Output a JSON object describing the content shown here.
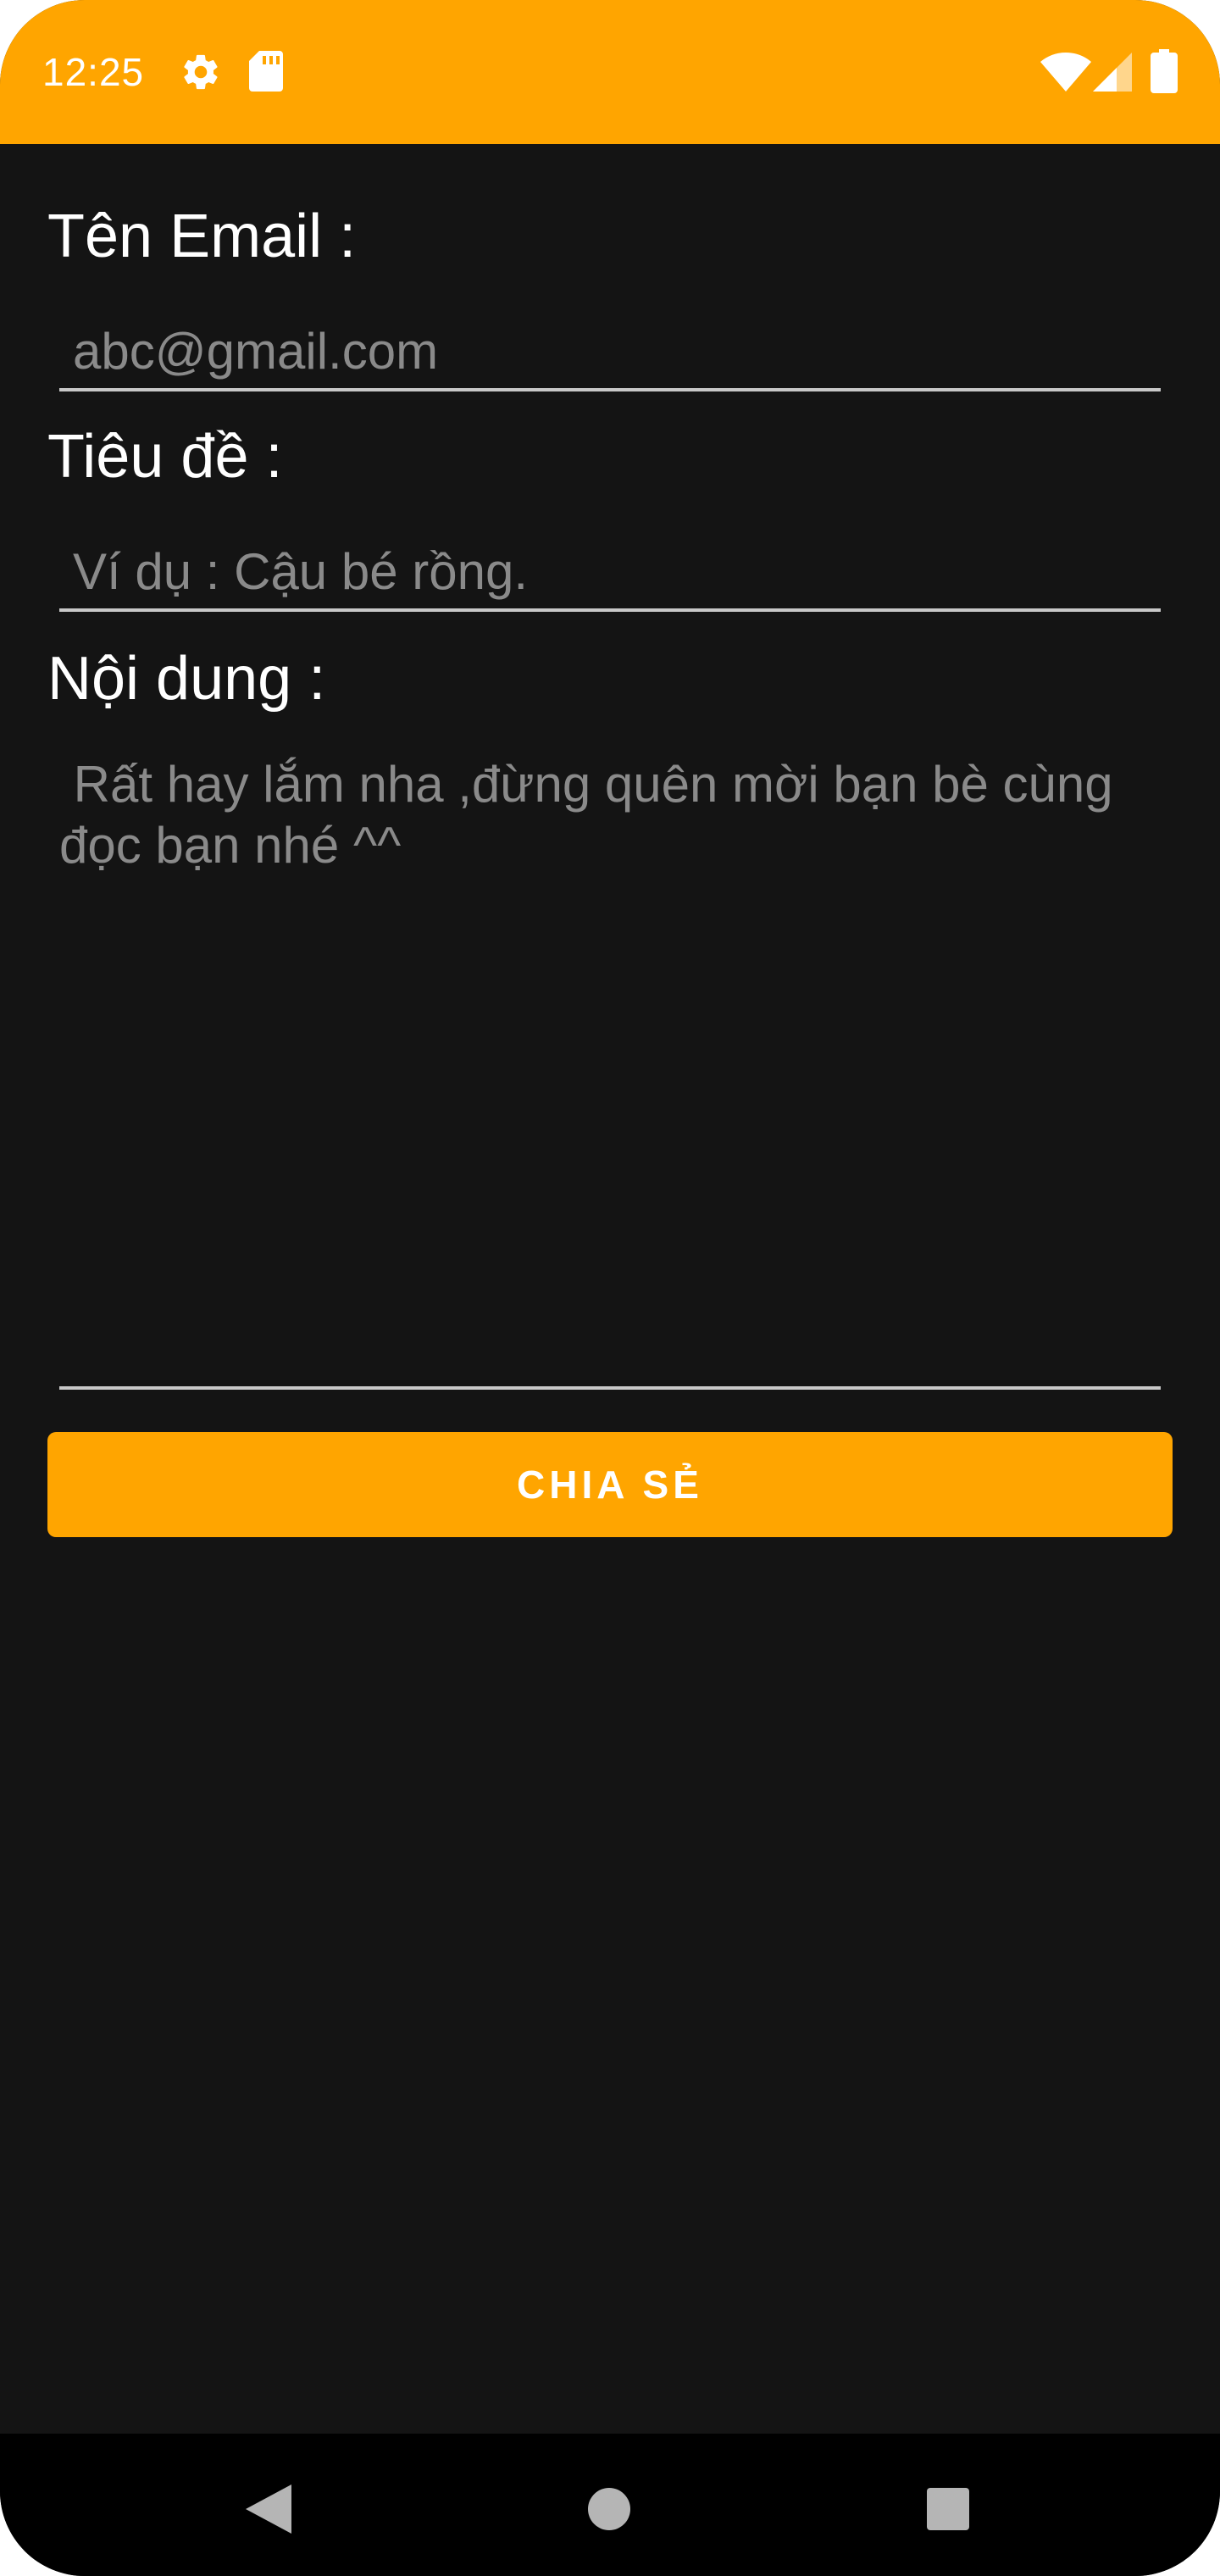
{
  "status_bar": {
    "time": "12:25",
    "icons": [
      "gear-icon",
      "sd-card-icon",
      "wifi-icon",
      "signal-icon",
      "battery-icon"
    ],
    "background": "#ffa500"
  },
  "form": {
    "email_label": "Tên Email :",
    "email_placeholder": "abc@gmail.com",
    "title_label": "Tiêu đề :",
    "title_placeholder": "Ví dụ : Cậu bé rồng.",
    "content_label": "Nội dung :",
    "content_placeholder": " Rất hay lắm nha ,đừng quên mời bạn bè cùng đọc bạn nhé ^^"
  },
  "share_button": {
    "label": "CHIA SẺ",
    "color": "#ffa500"
  },
  "nav_bar": {
    "icons": [
      "back-icon",
      "home-icon",
      "recents-icon"
    ]
  },
  "theme": {
    "accent": "#ffa500",
    "background": "#141414"
  }
}
